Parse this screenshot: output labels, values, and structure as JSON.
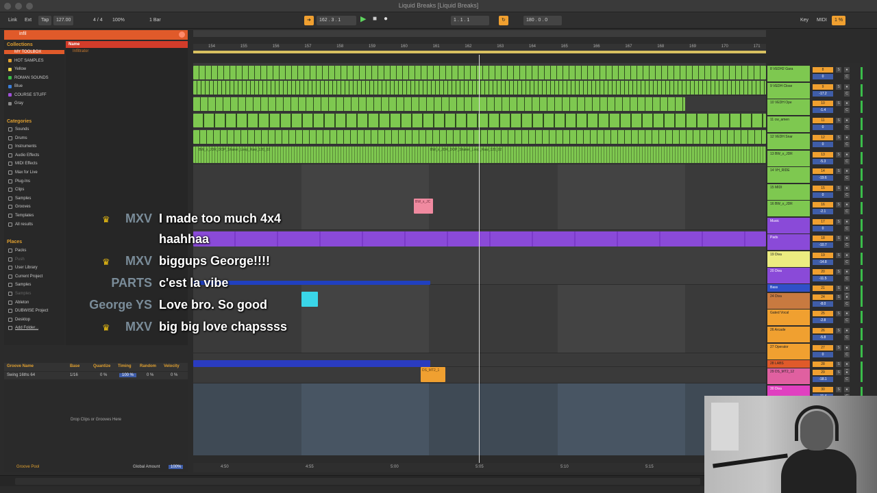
{
  "window": {
    "title": "Liquid Breaks  [Liquid Breaks]"
  },
  "controlbar": {
    "link": "Link",
    "ext": "Ext",
    "tap": "Tap",
    "tempo": "127.00",
    "signature": "4 / 4",
    "zoom": "100%",
    "quantize": "1 Bar",
    "position": "162 .   3 .   1",
    "loop_start": "1 .   1 .   1",
    "loop_length": "180 .   0 .   0",
    "key": "Key",
    "midi": "MIDI",
    "cpu": "1 %"
  },
  "browser": {
    "search_value": "infil",
    "collections_header": "Collections",
    "collections": [
      {
        "label": "MY TOOLBOX",
        "color": "#e05a2a"
      },
      {
        "label": "HOT SAMPLES",
        "color": "#e0a030"
      },
      {
        "label": "Yellow",
        "color": "#e8d24a"
      },
      {
        "label": "ROMAN SOUNDS",
        "color": "#3bbd4a"
      },
      {
        "label": "Blue",
        "color": "#3a7dd8"
      },
      {
        "label": "COURSE STUFF",
        "color": "#a050d8"
      },
      {
        "label": "Gray",
        "color": "#888888"
      }
    ],
    "categories_header": "Categories",
    "categories": [
      "Sounds",
      "Drums",
      "Instruments",
      "Audio Effects",
      "MIDI Effects",
      "Max for Live",
      "Plug-Ins",
      "Clips",
      "Samples",
      "Grooves",
      "Templates",
      "All results"
    ],
    "places_header": "Places",
    "places": [
      "Packs",
      "Push",
      "User Library",
      "Current Project",
      "Samples",
      "Samples",
      "Ableton",
      "DUBWISE Project",
      "Desktop",
      "Add Folder..."
    ],
    "name_header": "Name",
    "result": "Infiltrator"
  },
  "groove": {
    "col_name": "Groove Name",
    "col_base": "Base",
    "col_quantize": "Quantize",
    "col_timing": "Timing",
    "col_random": "Random",
    "col_velocity": "Velocity",
    "row_name": "Swing 16ths 64",
    "row_base": "1/16",
    "row_quantize": "0 %",
    "row_timing": "100 %",
    "row_random": "0 %",
    "row_velocity": "0 %",
    "drop": "Drop Clips or Grooves Here",
    "pool": "Groove Pool",
    "global_label": "Global Amount",
    "global_value": "100%"
  },
  "ruler": [
    "154",
    "155",
    "156",
    "157",
    "158",
    "159",
    "160",
    "161",
    "162",
    "163",
    "164",
    "165",
    "166",
    "167",
    "168",
    "169",
    "170",
    "171"
  ],
  "timeline": [
    "4:50",
    "4:55",
    "5:00",
    "5:05",
    "5:10",
    "5:15"
  ],
  "clips": {
    "shaker_a": "BW_x_JDR_DOP_Shaker_Loop_Raw_120_02",
    "shaker_b": "BW_x_JDR_DOP_Shaker_Loop_Raw_120_02",
    "pink": "BW_x_JC",
    "orange": "DS_MT2_1"
  },
  "mixer": [
    {
      "name": "8 VEDH2 Gara",
      "num": "8",
      "vol": "0",
      "color": "#7ec850"
    },
    {
      "name": "9 VEDH Close",
      "num": "9",
      "vol": "-17.2",
      "color": "#7ec850"
    },
    {
      "name": "10 VEDH Ope",
      "num": "10",
      "vol": "-1.4",
      "color": "#7ec850"
    },
    {
      "name": "11 cw_amen",
      "num": "11",
      "vol": "0",
      "color": "#7ec850"
    },
    {
      "name": "12 VEDH Snar",
      "num": "12",
      "vol": "0",
      "color": "#7ec850"
    },
    {
      "name": "13 BW_x_JDR",
      "num": "13",
      "vol": "-5.3",
      "color": "#7ec850"
    },
    {
      "name": "14 VH_RIDE",
      "num": "14",
      "vol": "-19.6",
      "color": "#7ec850"
    },
    {
      "name": "15 MIDI",
      "num": "15",
      "vol": "0",
      "color": "#7ec850"
    },
    {
      "name": "16 BW_x_JDR",
      "num": "16",
      "vol": "-2.1",
      "color": "#7ec850"
    },
    {
      "name": "Music",
      "num": "17",
      "vol": "0",
      "color": "#8a4ad8"
    },
    {
      "name": "Pads",
      "num": "18",
      "vol": "-10.7",
      "color": "#8a4ad8"
    },
    {
      "name": "19 Diva",
      "num": "19",
      "vol": "-14.8",
      "color": "#ecec80"
    },
    {
      "name": "20 Diva",
      "num": "20",
      "vol": "-11.5",
      "color": "#8a4ad8"
    },
    {
      "name": "Bass",
      "num": "21",
      "vol": "",
      "color": "#3050c8"
    },
    {
      "name": "24 Diva",
      "num": "24",
      "vol": "-8.0",
      "color": "#c87a40"
    },
    {
      "name": "Gated Vocal",
      "num": "25",
      "vol": "-2.8",
      "color": "#f0a030"
    },
    {
      "name": "26 Arcade",
      "num": "26",
      "vol": "-5.8",
      "color": "#f0a030"
    },
    {
      "name": "27 Operator",
      "num": "27",
      "vol": "0",
      "color": "#f0a030"
    },
    {
      "name": "28 LABS",
      "num": "28",
      "vol": "",
      "color": "#e05a2a"
    },
    {
      "name": "29 DS_MT2_12",
      "num": "29",
      "vol": "-18.1",
      "color": "#e060a0"
    },
    {
      "name": "30 Diva",
      "num": "30",
      "vol": "-11.4",
      "color": "#e040c0"
    }
  ],
  "chat": [
    {
      "user": "MXV",
      "message": "I made too much 4x4",
      "crown": true
    },
    {
      "user": "",
      "message": "haahhaa",
      "crown": false
    },
    {
      "user": "MXV",
      "message": "biggups George!!!!",
      "crown": true
    },
    {
      "user": "PARTS",
      "message": "c'est la vibe",
      "crown": false
    },
    {
      "user": "George YS",
      "message": "Love bro. So good",
      "crown": false
    },
    {
      "user": "MXV",
      "message": "big big love chapssss",
      "crown": true
    }
  ],
  "icons": {
    "crown": "crown-icon",
    "play": "play-icon",
    "stop": "stop-icon",
    "record": "record-icon"
  }
}
